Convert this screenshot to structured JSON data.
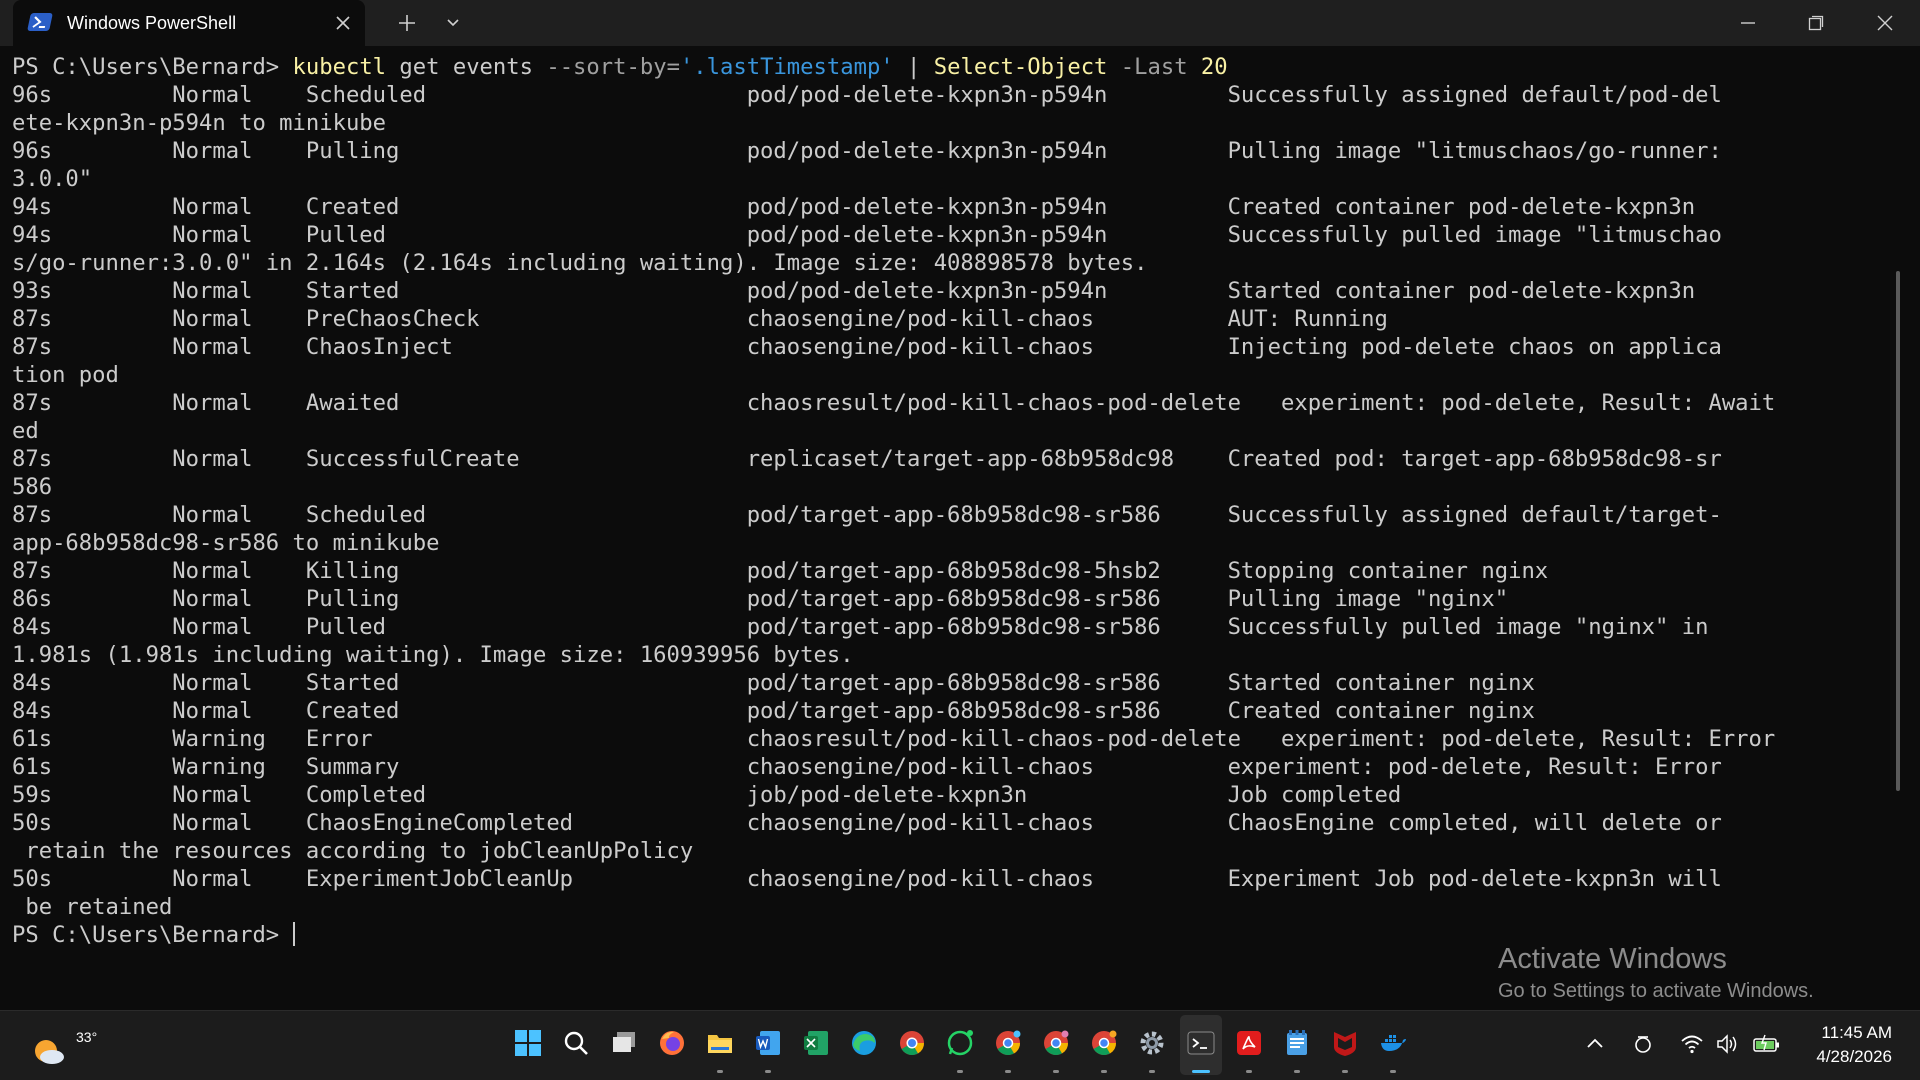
{
  "window": {
    "tab_title": "Windows PowerShell",
    "new_tab_symbol": "+",
    "icons": [
      "powershell-icon",
      "close-tab-icon",
      "new-tab-icon",
      "dropdown-icon",
      "minimize-icon",
      "restore-icon",
      "close-window-icon"
    ]
  },
  "terminal": {
    "prompt": "PS C:\\Users\\Bernard>",
    "command": {
      "cmd": "kubectl",
      "args": " get events ",
      "param": "--sort-by=",
      "value": "'.lastTimestamp'",
      "pipe": " | ",
      "cmd2": "Select-Object",
      "param2": " -Last ",
      "num": "20"
    },
    "lines": [
      "96s         Normal    Scheduled                        pod/pod-delete-kxpn3n-p594n         Successfully assigned default/pod-del",
      "ete-kxpn3n-p594n to minikube",
      "96s         Normal    Pulling                          pod/pod-delete-kxpn3n-p594n         Pulling image \"litmuschaos/go-runner:",
      "3.0.0\"",
      "94s         Normal    Created                          pod/pod-delete-kxpn3n-p594n         Created container pod-delete-kxpn3n",
      "94s         Normal    Pulled                           pod/pod-delete-kxpn3n-p594n         Successfully pulled image \"litmuschao",
      "s/go-runner:3.0.0\" in 2.164s (2.164s including waiting). Image size: 408898578 bytes.",
      "93s         Normal    Started                          pod/pod-delete-kxpn3n-p594n         Started container pod-delete-kxpn3n",
      "87s         Normal    PreChaosCheck                    chaosengine/pod-kill-chaos          AUT: Running",
      "87s         Normal    ChaosInject                      chaosengine/pod-kill-chaos          Injecting pod-delete chaos on applica",
      "tion pod",
      "87s         Normal    Awaited                          chaosresult/pod-kill-chaos-pod-delete   experiment: pod-delete, Result: Await",
      "ed",
      "87s         Normal    SuccessfulCreate                 replicaset/target-app-68b958dc98    Created pod: target-app-68b958dc98-sr",
      "586",
      "87s         Normal    Scheduled                        pod/target-app-68b958dc98-sr586     Successfully assigned default/target-",
      "app-68b958dc98-sr586 to minikube",
      "87s         Normal    Killing                          pod/target-app-68b958dc98-5hsb2     Stopping container nginx",
      "86s         Normal    Pulling                          pod/target-app-68b958dc98-sr586     Pulling image \"nginx\"",
      "84s         Normal    Pulled                           pod/target-app-68b958dc98-sr586     Successfully pulled image \"nginx\" in",
      "1.981s (1.981s including waiting). Image size: 160939956 bytes.",
      "84s         Normal    Started                          pod/target-app-68b958dc98-sr586     Started container nginx",
      "84s         Normal    Created                          pod/target-app-68b958dc98-sr586     Created container nginx",
      "61s         Warning   Error                            chaosresult/pod-kill-chaos-pod-delete   experiment: pod-delete, Result: Error",
      "61s         Warning   Summary                          chaosengine/pod-kill-chaos          experiment: pod-delete, Result: Error",
      "59s         Normal    Completed                        job/pod-delete-kxpn3n               Job completed",
      "50s         Normal    ChaosEngineCompleted             chaosengine/pod-kill-chaos          ChaosEngine completed, will delete or",
      " retain the resources according to jobCleanUpPolicy",
      "50s         Normal    ExperimentJobCleanUp             chaosengine/pod-kill-chaos          Experiment Job pod-delete-kxpn3n will",
      " be retained"
    ]
  },
  "watermark": {
    "title": "Activate Windows",
    "subtitle": "Go to Settings to activate Windows."
  },
  "taskbar": {
    "weather_temp": "33°",
    "apps": [
      "start-icon",
      "search-icon",
      "task-view-icon",
      "firefox-icon",
      "file-explorer-icon",
      "word-icon",
      "excel-icon",
      "edge-icon",
      "chrome-icon",
      "whatsapp-icon",
      "chrome-profile-2-icon",
      "chrome-profile-3-icon",
      "chrome-profile-4-icon",
      "settings-icon",
      "terminal-icon",
      "acrobat-icon",
      "notepad-icon",
      "mcafee-icon",
      "docker-icon"
    ],
    "tray": [
      "chevron-up-icon",
      "onedrive-icon",
      "wifi-icon",
      "volume-icon",
      "battery-icon"
    ],
    "time": "11:45 AM",
    "date": "4/28/2026"
  }
}
